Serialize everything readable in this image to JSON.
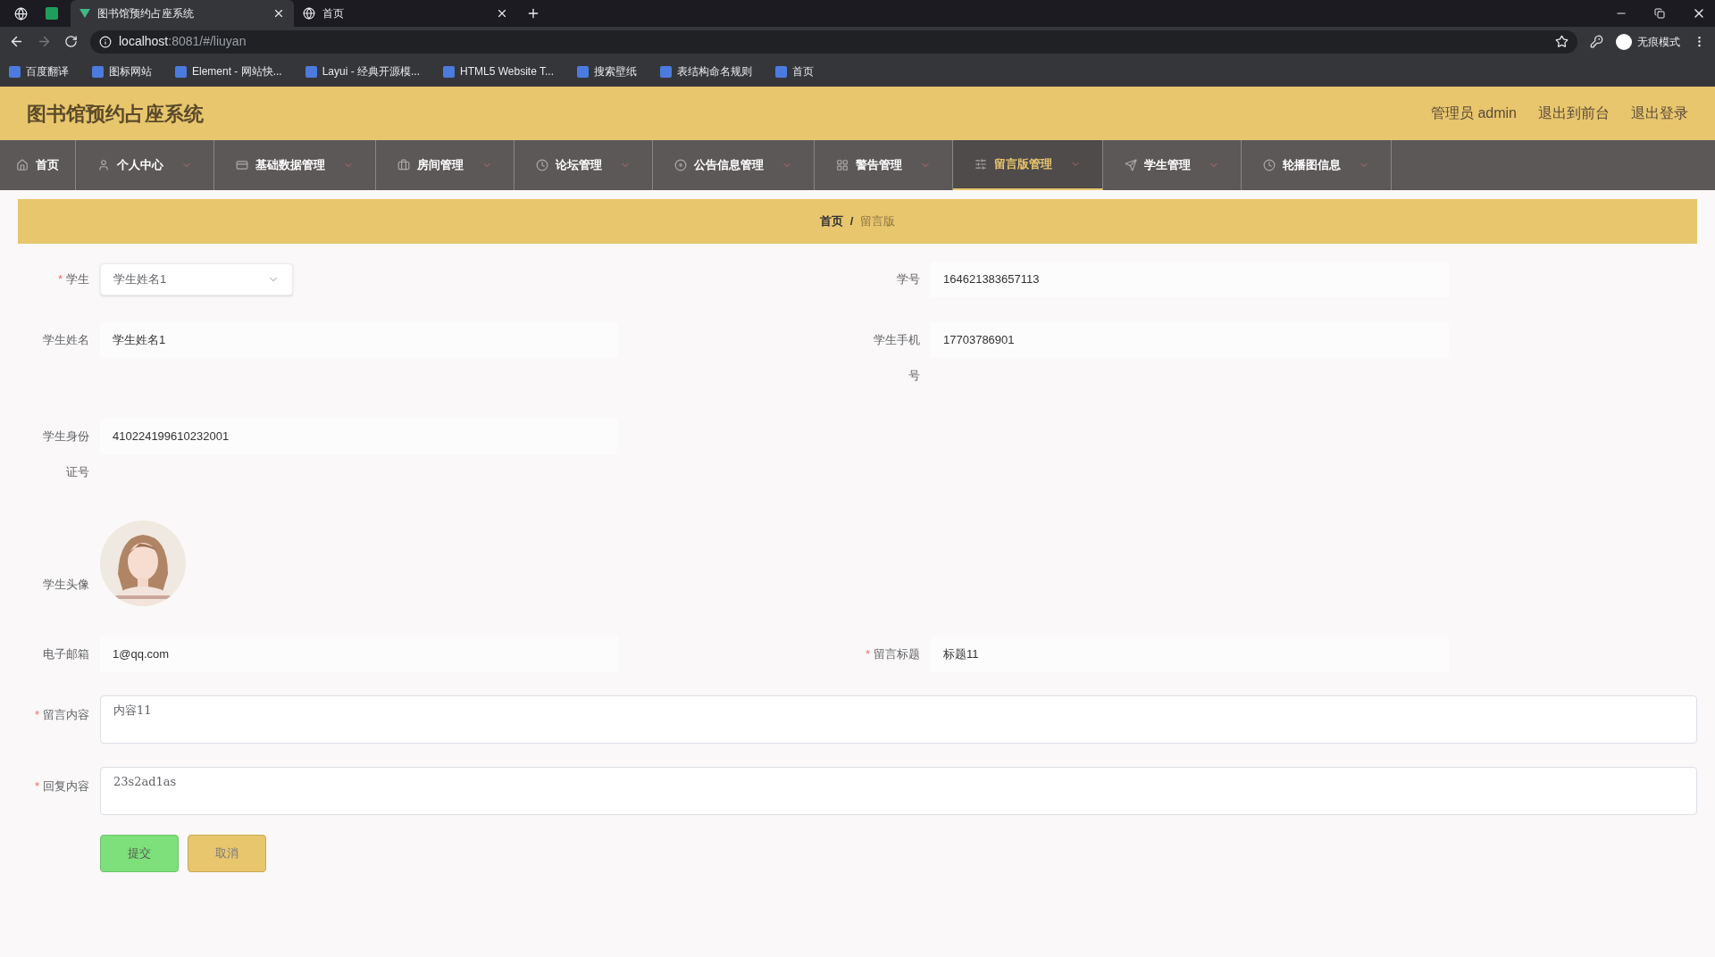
{
  "browser": {
    "tabs": [
      {
        "title": "图书馆预约占座系统",
        "selected": true
      },
      {
        "title": "首页",
        "selected": false
      }
    ],
    "url": {
      "host": "localhost",
      "path": ":8081/#/liuyan"
    },
    "bookmarks": [
      "百度翻译",
      "图标网站",
      "Element - 网站快...",
      "Layui - 经典开源模...",
      "HTML5 Website T...",
      "搜索壁纸",
      "表结构命名规则",
      "首页"
    ],
    "profile": "无痕模式"
  },
  "header": {
    "title": "图书馆预约占座系统",
    "links": [
      "管理员 admin",
      "退出到前台",
      "退出登录"
    ]
  },
  "nav": [
    {
      "label": "首页",
      "selected": false
    },
    {
      "label": "个人中心",
      "selected": false
    },
    {
      "label": "基础数据管理",
      "selected": false
    },
    {
      "label": "房间管理",
      "selected": false
    },
    {
      "label": "论坛管理",
      "selected": false
    },
    {
      "label": "公告信息管理",
      "selected": false
    },
    {
      "label": "警告管理",
      "selected": false
    },
    {
      "label": "留言版管理",
      "selected": true
    },
    {
      "label": "学生管理",
      "selected": false
    },
    {
      "label": "轮播图信息",
      "selected": false
    }
  ],
  "breadcrumb": {
    "separator": "/",
    "items": [
      {
        "label": "首页",
        "current": false
      },
      {
        "label": "留言版",
        "current": true
      }
    ]
  },
  "form": {
    "required_mark": "*",
    "rows": [
      [
        {
          "label": "学生",
          "required": true,
          "kind": "select",
          "value": "学生姓名1"
        },
        {
          "label": "学号",
          "required": false,
          "kind": "text",
          "value": "164621383657113"
        }
      ],
      [
        {
          "label": "学生姓名",
          "required": false,
          "kind": "text",
          "value": "学生姓名1"
        },
        {
          "label": "学生手机号",
          "required": false,
          "kind": "text",
          "value": "17703786901"
        }
      ],
      [
        {
          "label": "学生身份证号",
          "required": false,
          "kind": "text",
          "value": "410224199610232001"
        }
      ],
      [
        {
          "label": "学生头像",
          "required": false
        }
      ],
      [
        {
          "label": "电子邮箱",
          "required": false,
          "kind": "text",
          "value": "1@qq.com"
        },
        {
          "label": "留言标题",
          "required": true,
          "kind": "text",
          "value": "标题11"
        }
      ],
      [
        {
          "label": "留言内容",
          "required": true,
          "kind": "textarea",
          "value": "内容11"
        }
      ],
      [
        {
          "label": "回复内容",
          "required": true,
          "kind": "textarea",
          "value": "23s2ad1as"
        }
      ]
    ],
    "buttons": [
      {
        "label": "提交",
        "kind": "primary"
      },
      {
        "label": "取消",
        "kind": "secondary"
      }
    ]
  }
}
